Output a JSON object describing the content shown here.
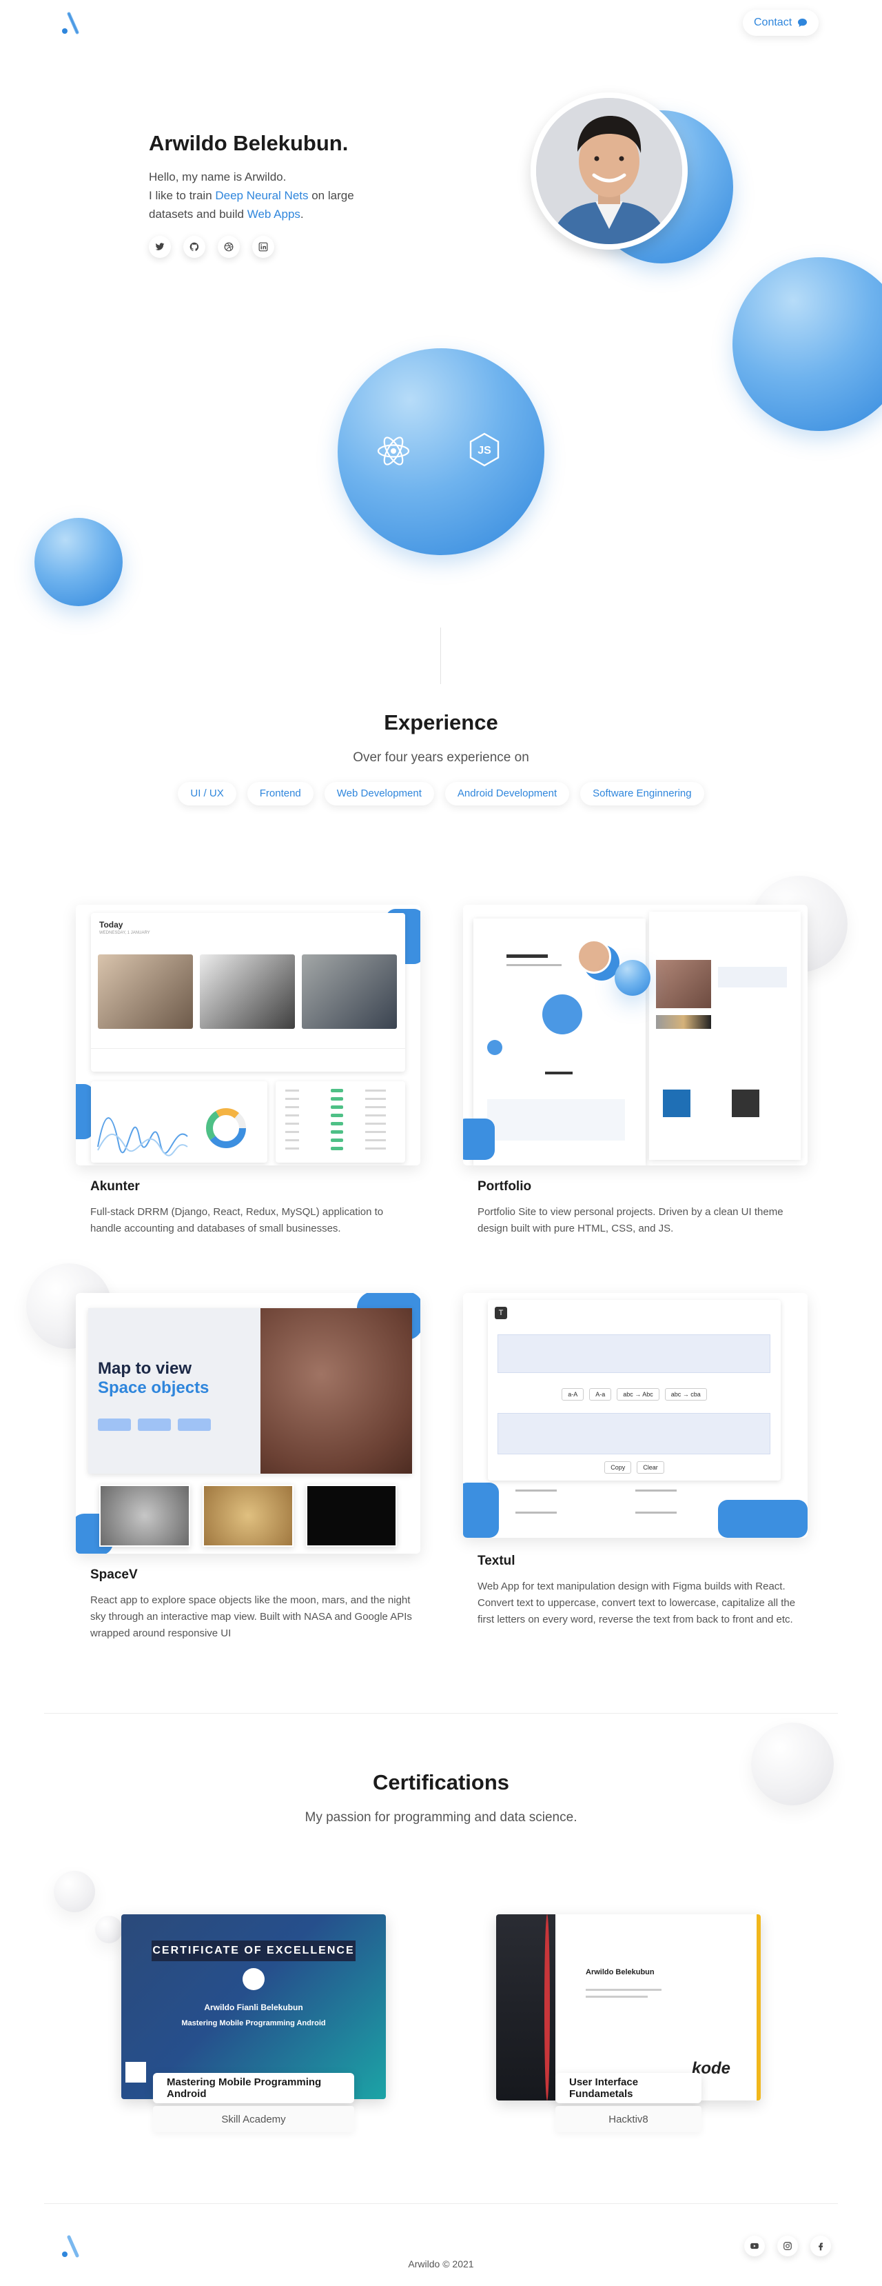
{
  "nav": {
    "contact_label": "Contact"
  },
  "hero": {
    "name": "Arwildo Belekubun.",
    "greeting": "Hello, my name is Arwildo.",
    "line2_prefix": "I like to train ",
    "line2_highlight": "Deep Neural Nets",
    "line2_suffix": " on large datasets and build ",
    "line2_highlight2": "Web Apps",
    "line2_end": ".",
    "socials": [
      "twitter-icon",
      "github-icon",
      "dribbble-icon",
      "linkedin-icon"
    ]
  },
  "skills": {
    "icons": [
      "react-icon",
      "nodejs-icon"
    ]
  },
  "experience": {
    "title": "Experience",
    "subtitle": "Over four years experience on",
    "tags": [
      "UI / UX",
      "Frontend",
      "Web Development",
      "Android Development",
      "Software Enginnering"
    ]
  },
  "projects": [
    {
      "title": "Akunter",
      "desc": "Full-stack DRRM (Django, React, Redux, MySQL) application to handle accounting and databases of small businesses.",
      "preview": {
        "today": "Today",
        "date": "WEDNESDAY, 1 JANUARY"
      }
    },
    {
      "title": "Portfolio",
      "desc": "Portfolio Site to view personal projects. Driven by a clean UI theme design built with pure HTML, CSS, and JS."
    },
    {
      "title": "SpaceV",
      "desc": "React app to explore space objects like the moon, mars, and the night sky through an interactive map view. Built with NASA and Google APIs wrapped around responsive UI",
      "preview": {
        "line1": "Map to view",
        "line2": "Space objects"
      }
    },
    {
      "title": "Textul",
      "desc": "Web App for text manipulation design with Figma builds with React. Convert text to uppercase, convert text to lowercase, capitalize all the first letters on every word, reverse the text from back to front and etc.",
      "preview": {
        "buttons": [
          "a-A",
          "A-a",
          "abc → Abc",
          "abc → cba"
        ],
        "copy": "Copy",
        "clear": "Clear"
      }
    }
  ],
  "certifications": {
    "title": "Certifications",
    "subtitle": "My passion for programming and data science.",
    "items": [
      {
        "name": "Mastering Mobile Programming Android",
        "org": "Skill Academy",
        "heading": "CERTIFICATE OF EXCELLENCE",
        "recipient": "Arwildo Fianli Belekubun"
      },
      {
        "name": "User Interface Fundametals",
        "org": "Hacktiv8",
        "recipient": "Arwildo Belekubun",
        "brand": "kode"
      }
    ]
  },
  "footer": {
    "copyright": "Arwildo © 2021",
    "socials": [
      "youtube-icon",
      "instagram-icon",
      "facebook-icon"
    ]
  },
  "colors": {
    "accent": "#2f86dc",
    "ball_light": "#b7dcf8",
    "ball_dark": "#2f86dc"
  }
}
